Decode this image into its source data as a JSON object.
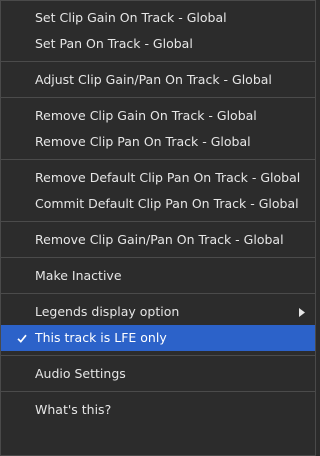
{
  "menu": {
    "items": [
      {
        "label": "Set Clip Gain On Track - Global"
      },
      {
        "label": "Set Pan On Track - Global"
      },
      {
        "label": "Adjust Clip Gain/Pan On Track - Global"
      },
      {
        "label": "Remove Clip Gain On Track - Global"
      },
      {
        "label": "Remove Clip Pan On Track - Global"
      },
      {
        "label": "Remove Default Clip Pan On Track - Global"
      },
      {
        "label": "Commit Default Clip Pan On Track - Global"
      },
      {
        "label": "Remove Clip Gain/Pan On Track - Global"
      },
      {
        "label": "Make Inactive"
      },
      {
        "label": "Legends display option",
        "submenu_icon": "chevron-right-icon"
      },
      {
        "label": "This track is LFE only",
        "checked": true,
        "highlighted": true,
        "check_icon": "checkmark-icon"
      },
      {
        "label": "Audio Settings"
      },
      {
        "label": "What's this?"
      }
    ]
  },
  "colors": {
    "background": "#2c2c2c",
    "text": "#e6e6e6",
    "highlight": "#2c62c9",
    "separator": "#4b4b4b"
  }
}
